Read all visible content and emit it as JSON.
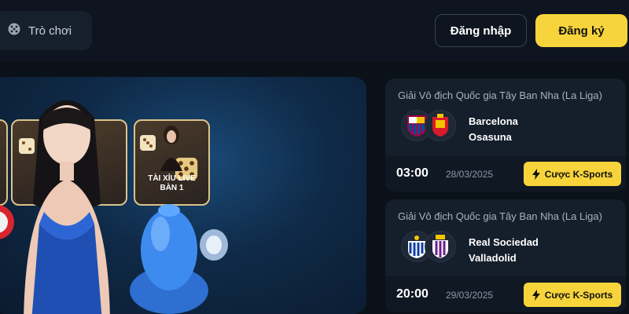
{
  "header": {
    "games_label": "Trò chơi",
    "login_label": "Đăng nhập",
    "register_label": "Đăng ký"
  },
  "banner": {
    "card_caption_line1": "TÀI XỈU LIVE",
    "card_caption_line2": "BÀN 1"
  },
  "matches": [
    {
      "league": "Giải Vô địch Quốc gia Tây Ban Nha (La Liga)",
      "home": "Barcelona",
      "away": "Osasuna",
      "time": "03:00",
      "date": "28/03/2025",
      "bet_label": "Cược K-Sports"
    },
    {
      "league": "Giải Vô địch Quốc gia Tây Ban Nha (La Liga)",
      "home": "Real Sociedad",
      "away": "Valladolid",
      "time": "20:00",
      "date": "29/03/2025",
      "bet_label": "Cược K-Sports"
    }
  ],
  "colors": {
    "accent": "#f7d43b",
    "background": "#0b1119",
    "card": "#151e2b"
  },
  "icons": {
    "games": "dice-icon",
    "bet": "lightning-icon"
  }
}
